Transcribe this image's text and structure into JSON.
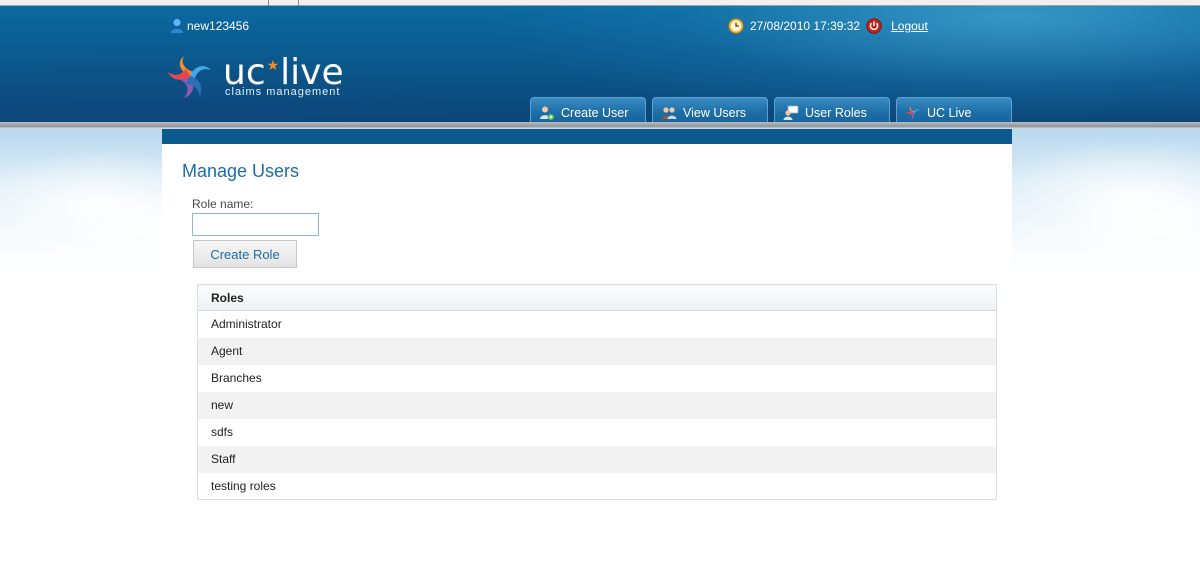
{
  "header": {
    "username": "new123456",
    "datetime": "27/08/2010 17:39:32",
    "logout_label": "Logout"
  },
  "logo": {
    "brand_part1": "uc",
    "brand_part2": "live",
    "tagline": "claims management"
  },
  "nav": {
    "tabs": [
      {
        "label": "Create User",
        "icon": "add-user-icon"
      },
      {
        "label": "View Users",
        "icon": "users-icon"
      },
      {
        "label": "User Roles",
        "icon": "user-roles-icon"
      },
      {
        "label": "UC Live",
        "icon": "uc-live-logo-icon"
      }
    ]
  },
  "main": {
    "title": "Manage Users",
    "role_name_label": "Role name:",
    "role_name_value": "",
    "create_button_label": "Create Role",
    "table": {
      "header": "Roles",
      "rows": [
        "Administrator",
        "Agent",
        "Branches",
        "new",
        "sdfs",
        "Staff",
        "testing roles"
      ]
    }
  },
  "colors": {
    "header_blue": "#0b5a8e",
    "link_blue": "#1b6da8",
    "brand_orange": "#f08a2a"
  }
}
